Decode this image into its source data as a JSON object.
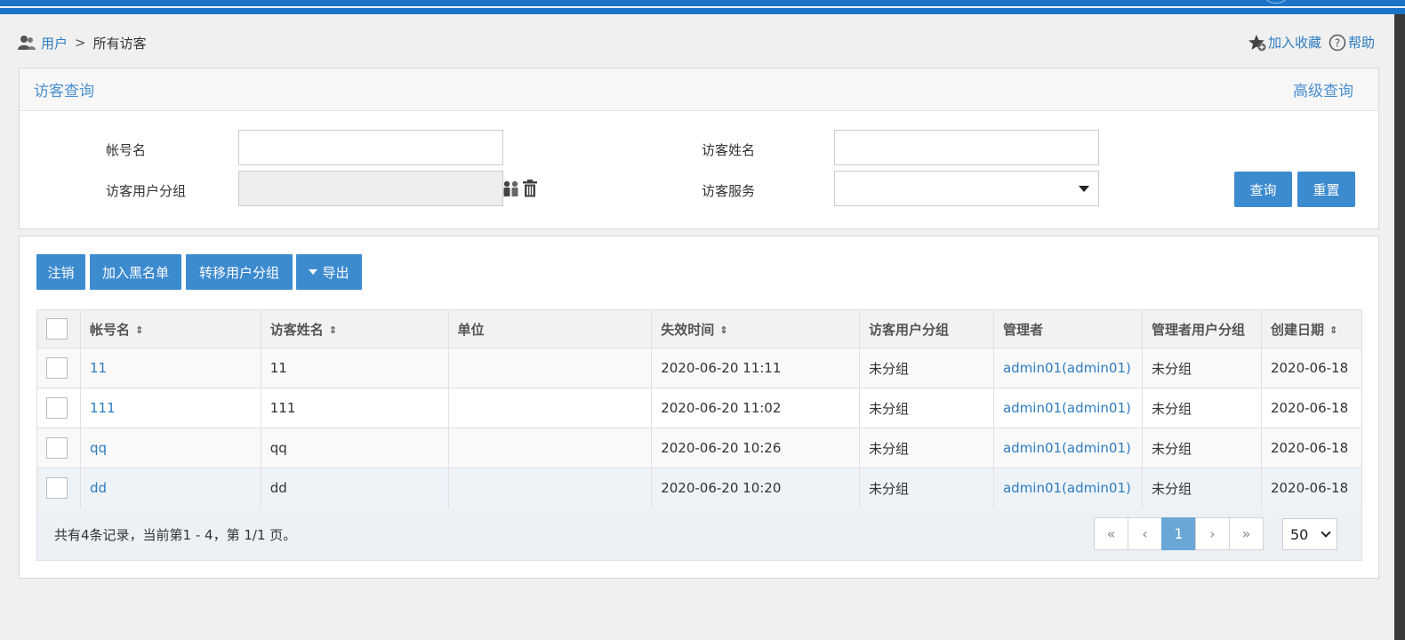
{
  "breadcrumb": {
    "root": "用户",
    "separator": ">",
    "current": "所有访客"
  },
  "top_actions": {
    "favorite": "加入收藏",
    "help": "帮助"
  },
  "search": {
    "title": "访客查询",
    "advanced": "高级查询",
    "account_label": "帐号名",
    "account_value": "",
    "name_label": "访客姓名",
    "name_value": "",
    "group_label": "访客用户分组",
    "group_value": "",
    "service_label": "访客服务",
    "service_value": "",
    "query_button": "查询",
    "reset_button": "重置"
  },
  "toolbar": {
    "logout": "注销",
    "blacklist": "加入黑名单",
    "move_group": "转移用户分组",
    "export": "导出"
  },
  "table": {
    "columns": [
      "帐号名",
      "访客姓名",
      "单位",
      "失效时间",
      "访客用户分组",
      "管理者",
      "管理者用户分组",
      "创建日期"
    ],
    "rows": [
      {
        "account": "11",
        "name": "11",
        "unit": "",
        "expire": "2020-06-20 11:11",
        "group": "未分组",
        "manager": "admin01(admin01)",
        "manager_group": "未分组",
        "created": "2020-06-18"
      },
      {
        "account": "111",
        "name": "111",
        "unit": "",
        "expire": "2020-06-20 11:02",
        "group": "未分组",
        "manager": "admin01(admin01)",
        "manager_group": "未分组",
        "created": "2020-06-18"
      },
      {
        "account": "qq",
        "name": "qq",
        "unit": "",
        "expire": "2020-06-20 10:26",
        "group": "未分组",
        "manager": "admin01(admin01)",
        "manager_group": "未分组",
        "created": "2020-06-18"
      },
      {
        "account": "dd",
        "name": "dd",
        "unit": "",
        "expire": "2020-06-20 10:20",
        "group": "未分组",
        "manager": "admin01(admin01)",
        "manager_group": "未分组",
        "created": "2020-06-18"
      }
    ]
  },
  "pagination": {
    "summary": "共有4条记录，当前第1 - 4，第 1/1 页。",
    "first": "«",
    "prev": "‹",
    "current_page": "1",
    "next": "›",
    "last": "»",
    "page_size": "50"
  },
  "colors": {
    "primary": "#3d8bcf",
    "link": "#2d7cc0",
    "topbar": "#1a73c8"
  },
  "icons": [
    "user-icon",
    "star-add-icon",
    "help-icon",
    "group-picker-icon",
    "trash-icon",
    "sort-icon",
    "caret-down-icon"
  ]
}
